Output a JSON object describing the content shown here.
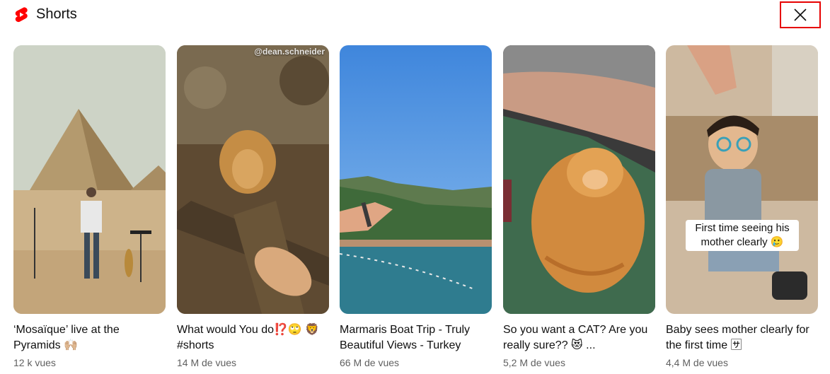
{
  "header": {
    "title": "Shorts",
    "logo_icon": "shorts-logo-icon",
    "close_icon": "close-icon",
    "accent": "#ff0000"
  },
  "shorts": [
    {
      "title": "‘Mosaïque’ live at the Pyramids 🙌🏼",
      "views": "12 k vues"
    },
    {
      "title": "What would You do⁉️🙄 🦁 #shorts",
      "views": "14 M de vues",
      "overlay": "@dean.schneider"
    },
    {
      "title": "Marmaris Boat Trip - Truly Beautiful Views - Turkey",
      "views": "66 M de vues"
    },
    {
      "title": "So you want a CAT? Are you really sure?? 😻 ...",
      "views": "5,2 M de vues"
    },
    {
      "title": "Baby sees mother clearly for the first time 🈂",
      "views": "4,4 M de vues",
      "caption": "First time seeing his mother clearly 🥲"
    }
  ]
}
